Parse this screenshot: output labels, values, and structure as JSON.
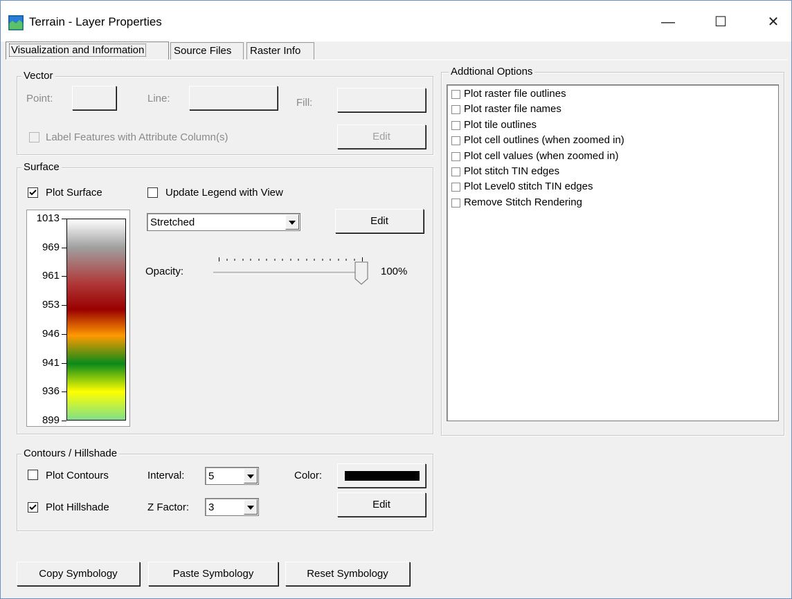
{
  "window": {
    "title": "Terrain - Layer Properties",
    "controls": {
      "minimize": "—",
      "maximize": "☐",
      "close": "✕"
    }
  },
  "tabs": [
    {
      "label": "Visualization and Information",
      "active": true
    },
    {
      "label": "Source Files",
      "active": false
    },
    {
      "label": "Raster Info",
      "active": false
    }
  ],
  "vector": {
    "group_label": "Vector",
    "point_label": "Point:",
    "line_label": "Line:",
    "fill_label": "Fill:",
    "label_features": "Label Features with Attribute Column(s)",
    "edit_label": "Edit"
  },
  "surface": {
    "group_label": "Surface",
    "plot_surface": "Plot Surface",
    "plot_surface_checked": true,
    "update_legend": "Update Legend with View",
    "update_legend_checked": false,
    "render_mode": "Stretched",
    "edit_label": "Edit",
    "opacity_label": "Opacity:",
    "opacity_value": "100%",
    "opacity_level": 1.0,
    "legend_ticks": [
      "1013",
      "969",
      "961",
      "953",
      "946",
      "941",
      "936",
      "899"
    ]
  },
  "contours": {
    "group_label": "Contours / Hillshade",
    "plot_contours": "Plot Contours",
    "plot_contours_checked": false,
    "plot_hillshade": "Plot Hillshade",
    "plot_hillshade_checked": true,
    "interval_label": "Interval:",
    "interval_value": "5",
    "zfactor_label": "Z Factor:",
    "zfactor_value": "3",
    "color_label": "Color:",
    "contour_color": "#000000",
    "edit_label": "Edit"
  },
  "additional": {
    "group_label": "Addtional Options",
    "options": [
      "Plot raster file outlines",
      "Plot raster file names",
      "Plot tile outlines",
      "Plot cell outlines (when zoomed in)",
      "Plot cell values (when zoomed in)",
      "Plot stitch TIN edges",
      "Plot Level0 stitch TIN edges",
      "Remove Stitch Rendering"
    ]
  },
  "footer": {
    "copy": "Copy Symbology",
    "paste": "Paste Symbology",
    "reset": "Reset Symbology"
  }
}
